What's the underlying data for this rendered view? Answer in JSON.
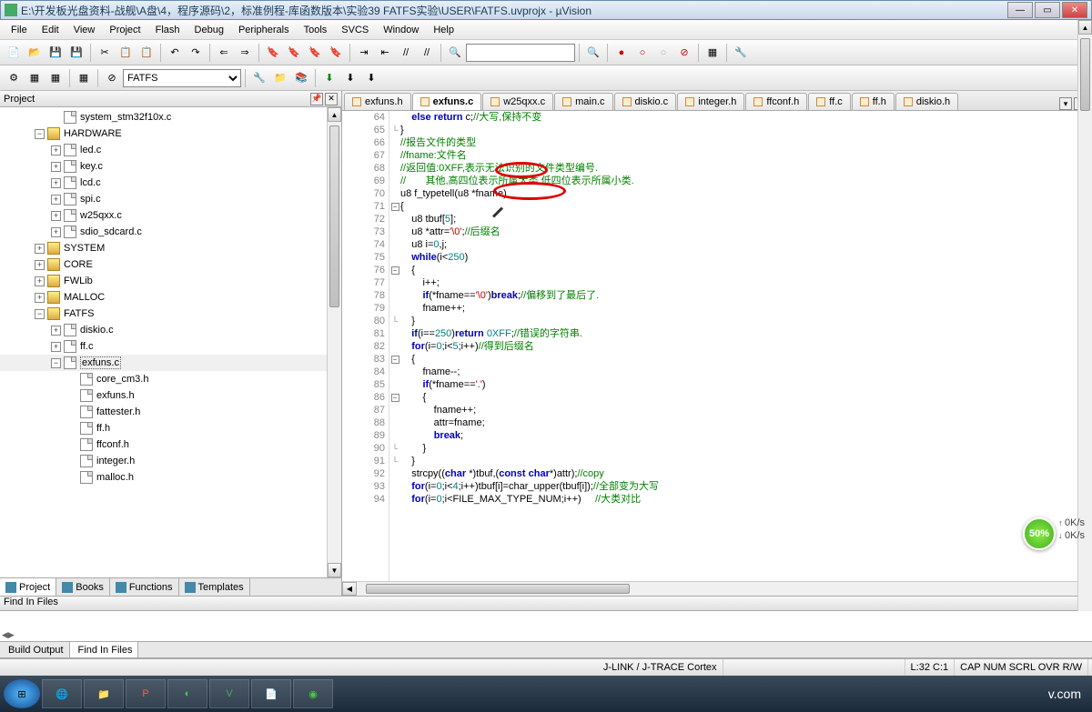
{
  "window": {
    "title": "E:\\开发板光盘资料-战舰\\A盘\\4，程序源码\\2，标准例程-库函数版本\\实验39 FATFS实验\\USER\\FATFS.uvprojx - µVision"
  },
  "menu": [
    "File",
    "Edit",
    "View",
    "Project",
    "Flash",
    "Debug",
    "Peripherals",
    "Tools",
    "SVCS",
    "Window",
    "Help"
  ],
  "target_combo": "FATFS",
  "project": {
    "title": "Project",
    "tabs": [
      "Project",
      "Books",
      "Functions",
      "Templates"
    ],
    "tree": [
      {
        "depth": 2,
        "exp": "none",
        "icon": "file",
        "label": "system_stm32f10x.c"
      },
      {
        "depth": 1,
        "exp": "minus",
        "icon": "folder",
        "label": "HARDWARE"
      },
      {
        "depth": 2,
        "exp": "plus",
        "icon": "file",
        "label": "led.c"
      },
      {
        "depth": 2,
        "exp": "plus",
        "icon": "file",
        "label": "key.c"
      },
      {
        "depth": 2,
        "exp": "plus",
        "icon": "file",
        "label": "lcd.c"
      },
      {
        "depth": 2,
        "exp": "plus",
        "icon": "file",
        "label": "spi.c"
      },
      {
        "depth": 2,
        "exp": "plus",
        "icon": "file",
        "label": "w25qxx.c"
      },
      {
        "depth": 2,
        "exp": "plus",
        "icon": "file",
        "label": "sdio_sdcard.c"
      },
      {
        "depth": 1,
        "exp": "plus",
        "icon": "folder",
        "label": "SYSTEM"
      },
      {
        "depth": 1,
        "exp": "plus",
        "icon": "folder",
        "label": "CORE"
      },
      {
        "depth": 1,
        "exp": "plus",
        "icon": "folder",
        "label": "FWLib"
      },
      {
        "depth": 1,
        "exp": "plus",
        "icon": "folder",
        "label": "MALLOC"
      },
      {
        "depth": 1,
        "exp": "minus",
        "icon": "folder",
        "label": "FATFS"
      },
      {
        "depth": 2,
        "exp": "plus",
        "icon": "file",
        "label": "diskio.c"
      },
      {
        "depth": 2,
        "exp": "plus",
        "icon": "file",
        "label": "ff.c"
      },
      {
        "depth": 2,
        "exp": "minus",
        "icon": "file",
        "label": "exfuns.c",
        "selected": true
      },
      {
        "depth": 3,
        "exp": "none",
        "icon": "file",
        "label": "core_cm3.h"
      },
      {
        "depth": 3,
        "exp": "none",
        "icon": "file",
        "label": "exfuns.h"
      },
      {
        "depth": 3,
        "exp": "none",
        "icon": "file",
        "label": "fattester.h"
      },
      {
        "depth": 3,
        "exp": "none",
        "icon": "file",
        "label": "ff.h"
      },
      {
        "depth": 3,
        "exp": "none",
        "icon": "file",
        "label": "ffconf.h"
      },
      {
        "depth": 3,
        "exp": "none",
        "icon": "file",
        "label": "integer.h"
      },
      {
        "depth": 3,
        "exp": "none",
        "icon": "file",
        "label": "malloc.h"
      }
    ]
  },
  "editor_tabs": [
    {
      "label": "exfuns.h"
    },
    {
      "label": "exfuns.c",
      "active": true
    },
    {
      "label": "w25qxx.c"
    },
    {
      "label": "main.c"
    },
    {
      "label": "diskio.c"
    },
    {
      "label": "integer.h"
    },
    {
      "label": "ffconf.h"
    },
    {
      "label": "ff.c"
    },
    {
      "label": "ff.h"
    },
    {
      "label": "diskio.h"
    }
  ],
  "code": {
    "start": 64,
    "lines": [
      {
        "n": 64,
        "html": "    <span class='kw'>else</span> <span class='kw'>return</span> c;<span class='cmt'>//大写,保持不变</span>"
      },
      {
        "n": 65,
        "html": "}",
        "fold": "end"
      },
      {
        "n": 66,
        "html": "<span class='cmt'>//报告文件的类型</span>"
      },
      {
        "n": 67,
        "html": "<span class='cmt'>//fname:文件名</span>"
      },
      {
        "n": 68,
        "html": "<span class='cmt'>//返回值:0XFF,表示无法识别的文件类型编号.</span>"
      },
      {
        "n": 69,
        "html": "<span class='cmt'>//       其他,高四位表示所属大类,低四位表示所属小类.</span>"
      },
      {
        "n": 70,
        "html": "u8 f_typetell(u8 *fname)"
      },
      {
        "n": 71,
        "html": "{",
        "fold": "minus"
      },
      {
        "n": 72,
        "html": "    u8 tbuf[<span class='num'>5</span>];"
      },
      {
        "n": 73,
        "html": "    u8 *attr=<span class='str'>'\\0'</span>;<span class='cmt'>//后缀名</span>"
      },
      {
        "n": 74,
        "html": "    u8 i=<span class='num'>0</span>,j;"
      },
      {
        "n": 75,
        "html": "    <span class='kw'>while</span>(i&lt;<span class='num'>250</span>)"
      },
      {
        "n": 76,
        "html": "    {",
        "fold": "minus"
      },
      {
        "n": 77,
        "html": "        i++;"
      },
      {
        "n": 78,
        "html": "        <span class='kw'>if</span>(*fname==<span class='str'>'\\0'</span>)<span class='kw'>break</span>;<span class='cmt'>//偏移到了最后了.</span>"
      },
      {
        "n": 79,
        "html": "        fname++;"
      },
      {
        "n": 80,
        "html": "    }",
        "fold": "end"
      },
      {
        "n": 81,
        "html": "    <span class='kw'>if</span>(i==<span class='num'>250</span>)<span class='kw'>return</span> <span class='num'>0XFF</span>;<span class='cmt'>//错误的字符串.</span>"
      },
      {
        "n": 82,
        "html": "    <span class='kw'>for</span>(i=<span class='num'>0</span>;i&lt;<span class='num'>5</span>;i++)<span class='cmt'>//得到后缀名</span>"
      },
      {
        "n": 83,
        "html": "    {",
        "fold": "minus"
      },
      {
        "n": 84,
        "html": "        fname--;"
      },
      {
        "n": 85,
        "html": "        <span class='kw'>if</span>(*fname==<span class='str'>'.'</span>)"
      },
      {
        "n": 86,
        "html": "        {",
        "fold": "minus"
      },
      {
        "n": 87,
        "html": "            fname++;"
      },
      {
        "n": 88,
        "html": "            attr=fname;"
      },
      {
        "n": 89,
        "html": "            <span class='kw'>break</span>;"
      },
      {
        "n": 90,
        "html": "        }",
        "fold": "end"
      },
      {
        "n": 91,
        "html": "    }",
        "fold": "end"
      },
      {
        "n": 92,
        "html": "    strcpy((<span class='kw'>char</span> *)tbuf,(<span class='kw'>const</span> <span class='kw'>char</span>*)attr);<span class='cmt'>//copy</span>"
      },
      {
        "n": 93,
        "html": "    <span class='kw'>for</span>(i=<span class='num'>0</span>;i&lt;<span class='num'>4</span>;i++)tbuf[i]=char_upper(tbuf[i]);<span class='cmt'>//全部变为大写</span>"
      },
      {
        "n": 94,
        "html": "    <span class='kw'>for</span>(i=<span class='num'>0</span>;i&lt;FILE_MAX_TYPE_NUM;i++)     <span class='cmt'>//大类对比</span>"
      }
    ]
  },
  "find": {
    "title": "Find In Files",
    "tab_build": "Build Output",
    "tab_find": "Find In Files"
  },
  "status": {
    "debugger": "J-LINK / J-TRACE Cortex",
    "pos": "L:32 C:1",
    "indicators": [
      "CAP",
      "NUM",
      "SCRL",
      "OVR",
      "R/W"
    ]
  },
  "speed": {
    "pct": "50%",
    "up": "0K/s",
    "down": "0K/s"
  },
  "tray": {
    "site": "v.com"
  }
}
